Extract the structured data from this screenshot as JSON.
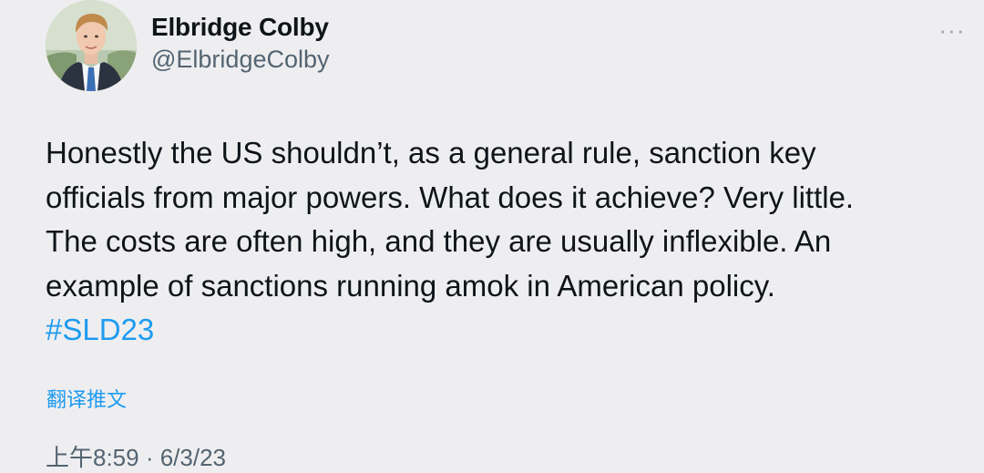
{
  "author": {
    "name": "Elbridge Colby",
    "handle": "@ElbridgeColby",
    "avatar_icon": "profile-photo"
  },
  "more_icon": "ellipsis-icon",
  "more_label": "···",
  "tweet": {
    "lines": [
      "Honestly the US shouldn’t, as a general rule, sanction key",
      "officials from major powers. What does it achieve? Very little.",
      "The costs are often high, and they are usually inflexible. An",
      "example of sanctions running amok in American policy."
    ],
    "hashtag": "#SLD23"
  },
  "translate_label": "翻译推文",
  "timestamp": "上午8:59 · 6/3/23",
  "colors": {
    "background": "#eeeef0",
    "text": "#0f1419",
    "secondary": "#536471",
    "link": "#1d9bf0"
  }
}
